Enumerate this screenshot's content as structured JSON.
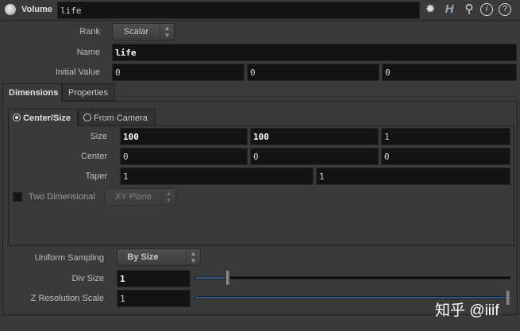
{
  "header": {
    "node_type": "Volume",
    "node_name": "life",
    "icons": [
      "volume-node-icon",
      "gear-icon",
      "houdini-h-icon",
      "search-icon",
      "info-icon",
      "help-icon"
    ]
  },
  "params": {
    "rank": {
      "label": "Rank",
      "value": "Scalar"
    },
    "name": {
      "label": "Name",
      "value": "life"
    },
    "initial_value": {
      "label": "Initial Value",
      "values": [
        "0",
        "0",
        "0"
      ]
    }
  },
  "tabs": [
    {
      "label": "Dimensions",
      "active": true
    },
    {
      "label": "Properties",
      "active": false
    }
  ],
  "dimensions": {
    "mode_tabs": [
      {
        "label": "Center/Size",
        "active": true
      },
      {
        "label": "From Camera",
        "active": false
      }
    ],
    "size": {
      "label": "Size",
      "values": [
        "100",
        "100",
        "1"
      ]
    },
    "center": {
      "label": "Center",
      "values": [
        "0",
        "0",
        "0"
      ]
    },
    "taper": {
      "label": "Taper",
      "values": [
        "1",
        "1"
      ]
    },
    "two_dimensional": {
      "label": "Two Dimensional",
      "checked": false,
      "plane": "XY Plane"
    }
  },
  "sampling": {
    "uniform_sampling": {
      "label": "Uniform Sampling",
      "value": "By Size"
    },
    "div_size": {
      "label": "Div Size",
      "value": "1",
      "slider_fraction": 0.1
    },
    "z_resolution_scale": {
      "label": "Z Resolution Scale",
      "value": "1",
      "slider_fraction": 1.0
    }
  },
  "watermark": "知乎 @iiif",
  "colors": {
    "accent": "#2d5a90",
    "field_bg": "#131313",
    "panel_bg": "#3a3a3a"
  }
}
